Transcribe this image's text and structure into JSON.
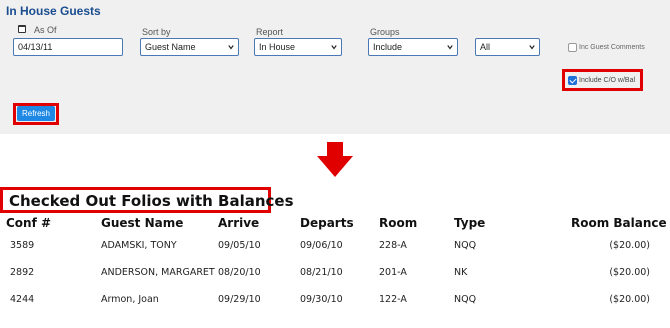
{
  "panel": {
    "title": "In House Guests",
    "as_of": {
      "label": "As Of",
      "value": "04/13/11"
    },
    "sort_by": {
      "label": "Sort by",
      "value": "Guest Name"
    },
    "report": {
      "label": "Report",
      "value": "In House"
    },
    "groups": {
      "label": "Groups",
      "value": "Include"
    },
    "groups_filter": {
      "value": "All"
    },
    "inc_guest_comments": {
      "label": "Inc Guest Comments",
      "checked": false
    },
    "include_co_bal": {
      "label": "Include C/O w/Bal",
      "checked": true
    },
    "refresh_label": "Refresh"
  },
  "report": {
    "title": "Checked Out Folios with Balances",
    "columns": [
      "Conf #",
      "Guest Name",
      "Arrive",
      "Departs",
      "Room",
      "Type",
      "Room Balance"
    ],
    "rows": [
      [
        "3589",
        "ADAMSKI, TONY",
        "09/05/10",
        "09/06/10",
        "228-A",
        "NQQ",
        "($20.00)"
      ],
      [
        "2892",
        "ANDERSON, MARGARET",
        "08/20/10",
        "08/21/10",
        "201-A",
        "NK",
        "($20.00)"
      ],
      [
        "4244",
        "Armon, Joan",
        "09/29/10",
        "09/30/10",
        "122-A",
        "NQQ",
        "($20.00)"
      ]
    ]
  },
  "colors": {
    "highlight": "#e00000",
    "accent": "#1e88e5",
    "title_blue": "#1a4d8f"
  },
  "icons": [
    "calendar-icon",
    "chevron-down-icon",
    "down-arrow-icon",
    "checkbox-icon"
  ]
}
